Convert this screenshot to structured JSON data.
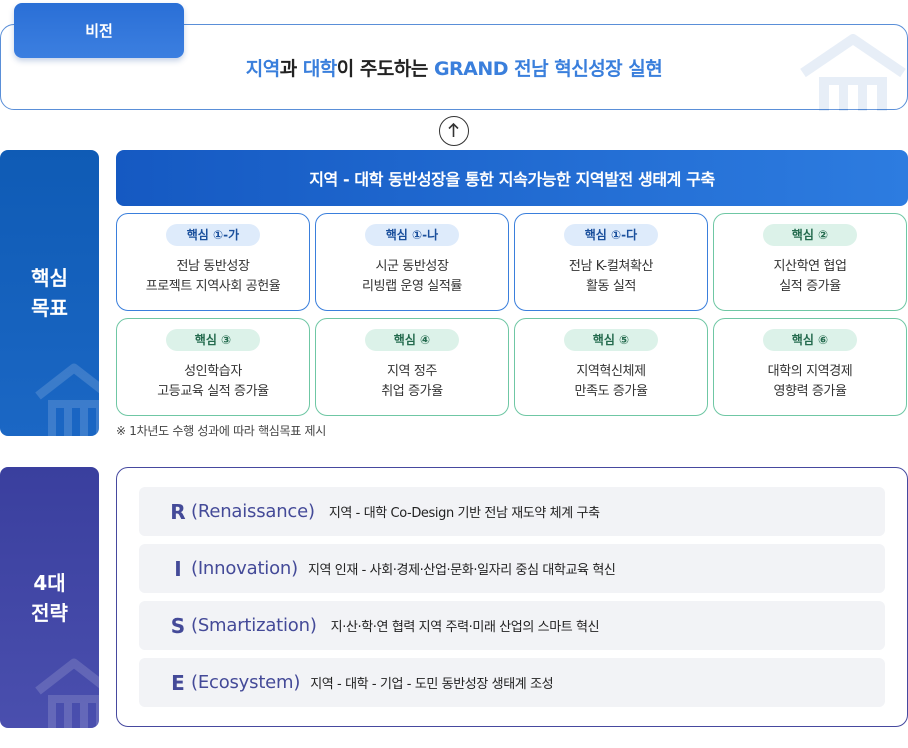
{
  "vision": {
    "tab_label": "비전",
    "statement_hl1": "지역",
    "statement_mid1": "과 ",
    "statement_hl2": "대학",
    "statement_mid2": "이 주도하는 ",
    "statement_hl3": "GRAND 전남 혁신성장 실현"
  },
  "core_goals": {
    "side_label_line1": "핵심",
    "side_label_line2": "목표",
    "banner": "지역 - 대학 동반성장을 통한 지속가능한 지역발전 생태계 구축",
    "cards": [
      {
        "badge": "핵심 ①-가",
        "line1": "전남 동반성장",
        "line2": "프로젝트 지역사회 공헌율",
        "color": "blue"
      },
      {
        "badge": "핵심 ①-나",
        "line1": "시군 동반성장",
        "line2": "리빙랩 운영 실적률",
        "color": "blue"
      },
      {
        "badge": "핵심 ①-다",
        "line1": "전남 K-컬쳐확산",
        "line2": "활동 실적",
        "color": "blue"
      },
      {
        "badge": "핵심 ②",
        "line1": "지산학연 협업",
        "line2": "실적 증가율",
        "color": "green"
      },
      {
        "badge": "핵심 ③",
        "line1": "성인학습자",
        "line2": "고등교육 실적 증가율",
        "color": "green"
      },
      {
        "badge": "핵심 ④",
        "line1": "지역 정주",
        "line2": "취업 증가율",
        "color": "green"
      },
      {
        "badge": "핵심 ⑤",
        "line1": "지역혁신체제",
        "line2": "만족도 증가율",
        "color": "green"
      },
      {
        "badge": "핵심 ⑥",
        "line1": "대학의 지역경제",
        "line2": "영향력 증가율",
        "color": "green"
      }
    ],
    "note": "※ 1차년도 수행 성과에 따라 핵심목표 제시"
  },
  "strategies": {
    "side_label_line1": "4대",
    "side_label_line2": "전략",
    "items": [
      {
        "letter": "R",
        "word": "(Renaissance)",
        "desc": "지역 - 대학 Co-Design 기반 전남 재도약 체계 구축"
      },
      {
        "letter": "I",
        "word": "(Innovation)",
        "desc": "지역 인재 - 사회·경제·산업·문화·일자리 중심 대학교육 혁신"
      },
      {
        "letter": "S",
        "word": "(Smartization)",
        "desc": "지·산·학·연 협력 지역 주력·미래 산업의 스마트 혁신"
      },
      {
        "letter": "E",
        "word": "(Ecosystem)",
        "desc": "지역 - 대학 - 기업 - 도민 동반성장 생태계 조성"
      }
    ]
  },
  "colors": {
    "vision_accent": "#3a7fdc",
    "core_blue": "#1559c2",
    "goal_green": "#6fc7a4",
    "strategy_purple": "#444a98"
  },
  "icons": [
    "up-arrow-icon",
    "building-watermark-icon"
  ]
}
